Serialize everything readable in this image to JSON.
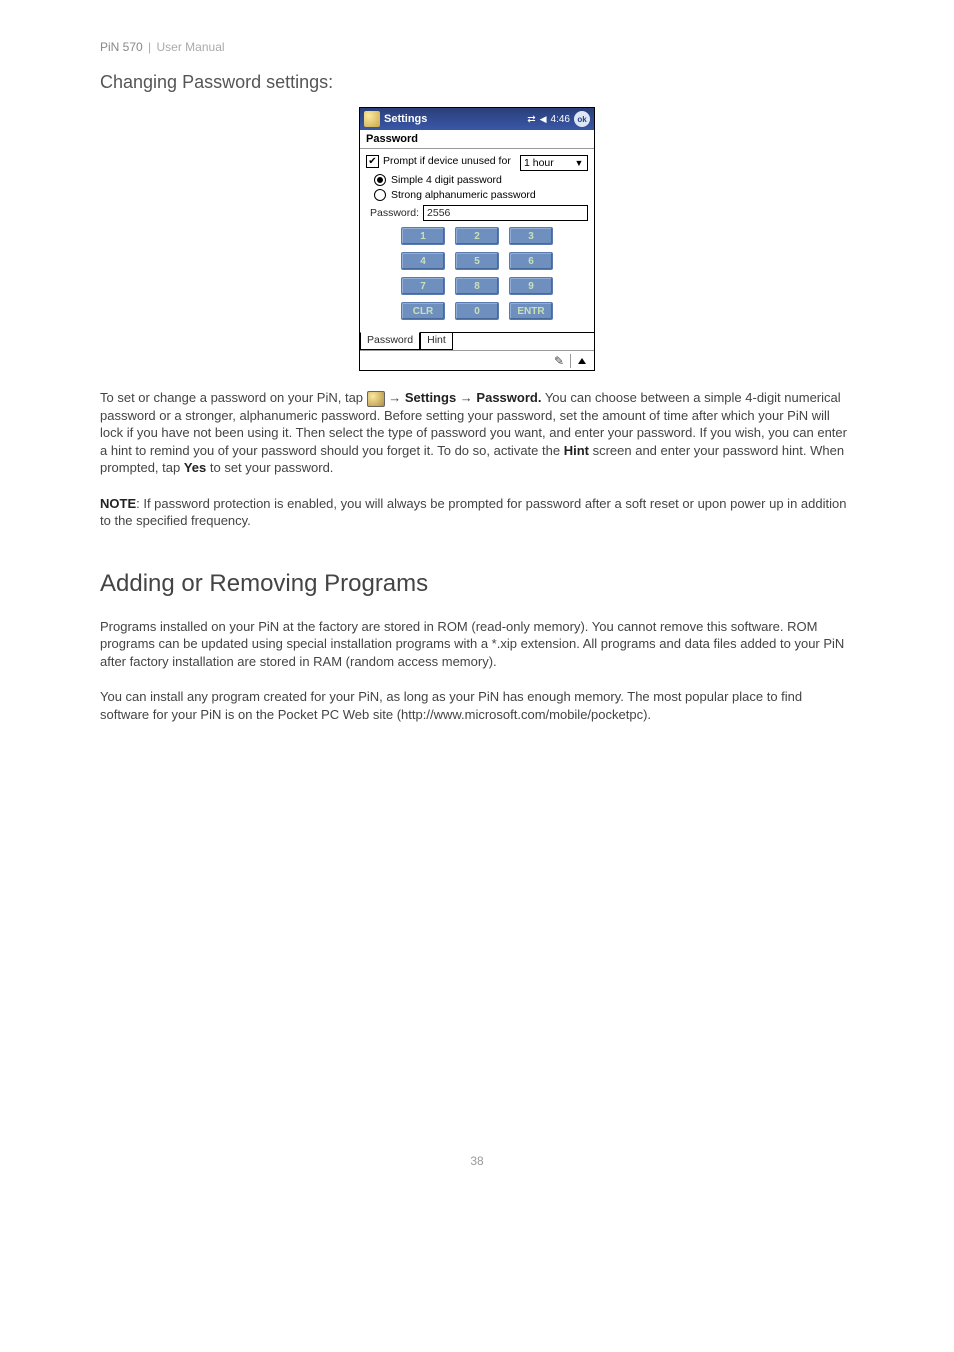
{
  "header": {
    "product": "PiN 570",
    "doc_type": "User Manual"
  },
  "section1_title": "Changing Password settings:",
  "device": {
    "titlebar": {
      "title": "Settings",
      "time": "4:46",
      "ok": "ok"
    },
    "screen_title": "Password",
    "prompt": {
      "checked": true,
      "label": "Prompt if device unused for",
      "select_value": "1 hour"
    },
    "radios": {
      "opt1": {
        "selected": true,
        "label": "Simple 4 digit password"
      },
      "opt2": {
        "selected": false,
        "label": "Strong alphanumeric password"
      }
    },
    "password_label": "Password:",
    "password_value": "2556",
    "keypad": [
      "1",
      "2",
      "3",
      "4",
      "5",
      "6",
      "7",
      "8",
      "9",
      "CLR",
      "0",
      "ENTR"
    ],
    "tabs": {
      "password": "Password",
      "hint": "Hint"
    }
  },
  "para1": {
    "pre": "To set or change a password on your PiN, tap ",
    "arrow1": " → ",
    "settings": "Settings",
    "arrow2": " → ",
    "password": "Password.",
    "post": "  You can choose between a simple 4-digit numerical password or a stronger, alphanumeric password. Before setting your password, set the amount of time after which your PiN will lock if you have not been using it. Then select the type of password you want, and enter your password. If you wish, you can enter a hint to remind you of your password should you forget it.  To do so, activate the ",
    "hint": "Hint",
    "post2": " screen and enter your password hint. When prompted, tap ",
    "yes": "Yes",
    "post3": " to set your password."
  },
  "note": {
    "label": "NOTE",
    "text": ": If password protection is enabled, you will always be prompted for password after a soft reset or upon power up in addition to the specified frequency."
  },
  "section2_title": "Adding or Removing Programs",
  "para2": "Programs installed on your PiN at the factory are stored in ROM (read-only memory). You cannot remove this software. ROM programs can be updated using special installation programs with a *.xip extension. All programs and data files added to your PiN after factory installation are stored in RAM (random access memory).",
  "para3": "You can install any program created for your PiN, as long as your PiN has enough memory. The most popular place to find software for your PiN is on the Pocket PC Web site (http://www.microsoft.com/mobile/pocketpc).",
  "page_number": "38"
}
